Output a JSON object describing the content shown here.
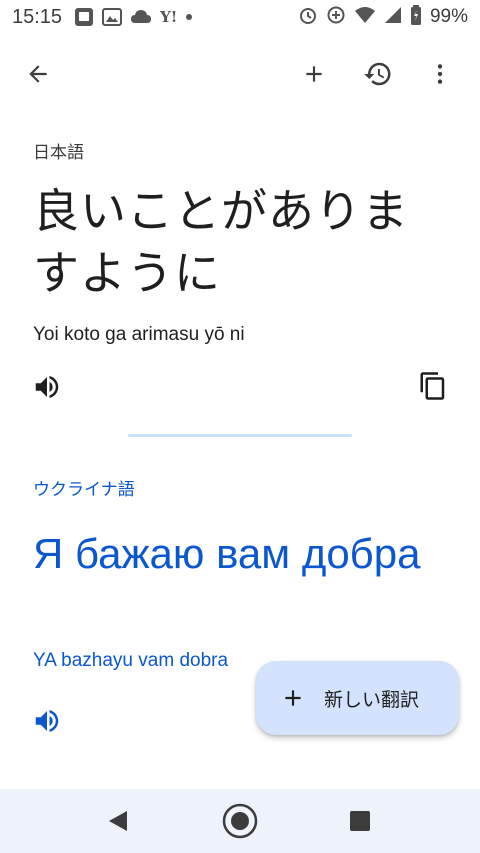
{
  "status_bar": {
    "time": "15:15",
    "battery_percent": "99%",
    "left_icons": [
      "photo-notification-icon",
      "gallery-icon",
      "cloud-notification-icon",
      "yahoo-icon",
      "dot-icon"
    ],
    "right_icons": [
      "alarm-icon",
      "data-saver-icon",
      "wifi-icon",
      "signal-icon",
      "battery-icon"
    ]
  },
  "toolbar": {
    "back_icon": "arrow-back-icon",
    "add_icon": "plus-icon",
    "history_icon": "history-icon",
    "more_icon": "more-vert-icon"
  },
  "source": {
    "language": "日本語",
    "text": "良いことがありますように",
    "transliteration": "Yoi koto ga arimasu yō ni"
  },
  "target": {
    "language": "ウクライナ語",
    "text": "Я бажаю вам добра",
    "transliteration": "YA bazhayu vam dobra"
  },
  "fab": {
    "label": "新しい翻訳"
  },
  "colors": {
    "accent_blue": "#0b57d0",
    "fab_background": "#d3e3fd",
    "divider": "#c8e3fa",
    "navbar_background": "#eef2fb"
  }
}
